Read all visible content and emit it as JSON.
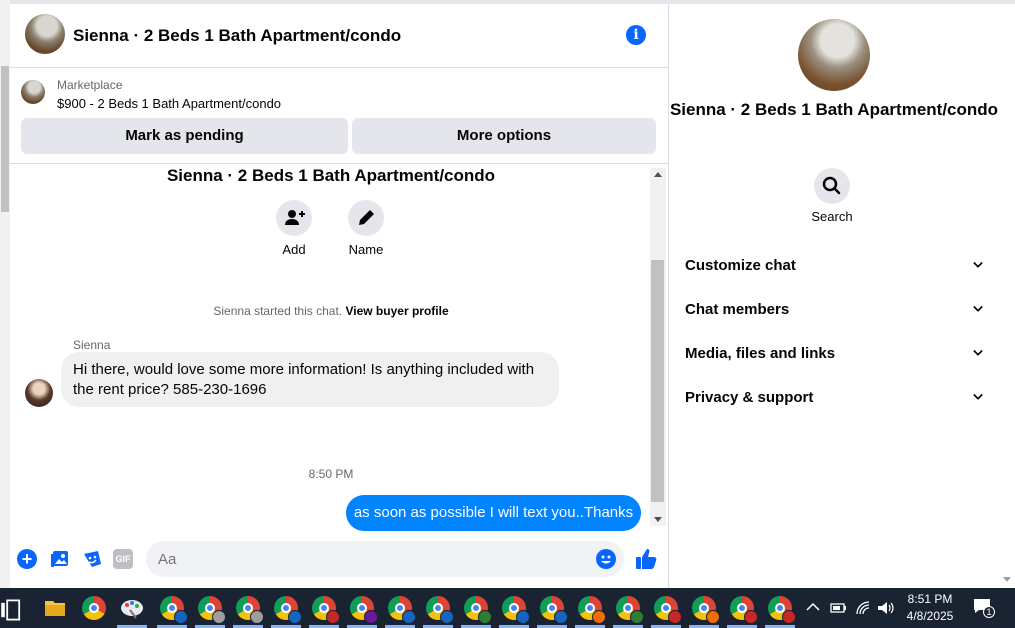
{
  "header": {
    "title": "Sienna · 2 Beds 1 Bath Apartment/condo",
    "info_icon": "info-icon"
  },
  "marketplace": {
    "label": "Marketplace",
    "listing": "$900 - 2 Beds 1 Bath Apartment/condo",
    "mark_pending": "Mark as pending",
    "more_options": "More options"
  },
  "conversation": {
    "title": "Sienna · 2 Beds 1 Bath Apartment/condo",
    "add_label": "Add",
    "name_label": "Name",
    "started_text": "Sienna started this chat.",
    "buyer_profile_link": "View buyer profile",
    "sender_name": "Sienna",
    "incoming_message": "Hi there, would love some more information! Is anything included with the rent price? 585-230-1696",
    "timestamp": "8:50 PM",
    "outgoing_message": "as soon as possible I will text you..Thanks"
  },
  "composer": {
    "placeholder": "Aa",
    "gif_label": "GIF",
    "plus": "+"
  },
  "info_panel": {
    "title": "Sienna · 2 Beds 1 Bath Apartment/condo",
    "search_label": "Search",
    "sections": [
      {
        "label": "Customize chat"
      },
      {
        "label": "Chat members"
      },
      {
        "label": "Media, files and links"
      },
      {
        "label": "Privacy & support"
      }
    ]
  },
  "taskbar": {
    "time": "8:51 PM",
    "date": "4/8/2025",
    "notification_count": "1"
  },
  "colors": {
    "accent": "#0866ff",
    "outgoing_bubble": "#0084ff",
    "incoming_bubble": "#f0f0f0",
    "button_bg": "#e4e6eb",
    "taskbar_bg": "#1a2332"
  }
}
